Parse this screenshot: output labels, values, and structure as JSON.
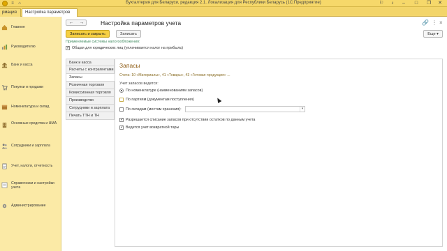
{
  "window": {
    "title": "Бухгалтерия для Беларуси, редакция 2.1. Локализация для Республики Беларусь   (1С:Предприятие)"
  },
  "tabs": [
    {
      "label": "рмация"
    },
    {
      "label": "Настройка параметров учета"
    }
  ],
  "sidebar": {
    "items": [
      {
        "label": "Главное",
        "icon": "home-icon"
      },
      {
        "label": "Руководителю",
        "icon": "chart-icon"
      },
      {
        "label": "Банк и касса",
        "icon": "bank-icon"
      },
      {
        "label": "Покупки и продажи",
        "icon": "cart-icon"
      },
      {
        "label": "Номенклатура и склад",
        "icon": "box-icon"
      },
      {
        "label": "Основные средства и НМА",
        "icon": "building-icon"
      },
      {
        "label": "Сотрудники и зарплата",
        "icon": "people-icon"
      },
      {
        "label": "Учет, налоги, отчетность",
        "icon": "report-icon"
      },
      {
        "label": "Справочники и настройки учета",
        "icon": "settings-icon"
      },
      {
        "label": "Администрирование",
        "icon": "gear-icon"
      }
    ]
  },
  "form": {
    "title": "Настройка параметров учета",
    "save_close_label": "Записать и закрыть",
    "save_label": "Записать",
    "more_label": "Еще ▾",
    "tax_systems_label": "Применяемые системы налогообложения:",
    "general_tax_label": "Общая для юридических лиц (уплачивается налог на прибыль)",
    "general_tax_checked": true
  },
  "side_tabs": [
    {
      "label": "Банк и касса"
    },
    {
      "label": "Расчеты с контрагентами"
    },
    {
      "label": "Запасы"
    },
    {
      "label": "Розничная торговля"
    },
    {
      "label": "Комиссионная торговля"
    },
    {
      "label": "Производство"
    },
    {
      "label": "Сотрудники и зарплата"
    },
    {
      "label": "Печать ТТН и ТН"
    }
  ],
  "panel": {
    "title": "Запасы",
    "accounts_link": "Счета: 10 «Материалы», 41 «Товары», 43 «Готовая продукция» ...",
    "inventory_label": "Учет запасов ведется:",
    "by_item_label": "По номенклатуре (наименованиям запасов)",
    "by_batch_label": "По партиям (документам поступления)",
    "by_warehouse_label": "По складам (местам хранения):",
    "allow_writeoff_label": "Разрешается списание запасов при отсутствии остатков по данным учета",
    "returnable_tare_label": "Ведется учет возвратной тары",
    "by_item_checked": true,
    "by_batch_checked": false,
    "by_warehouse_checked": false,
    "allow_writeoff_checked": true,
    "returnable_tare_checked": true
  },
  "colors": {
    "accent": "#f6cf40",
    "sidebar_bg": "#fbeaa6",
    "titlebar_bg": "#f6d86a",
    "section_green": "#3e8a5e",
    "panel_title": "#8d5a12"
  }
}
